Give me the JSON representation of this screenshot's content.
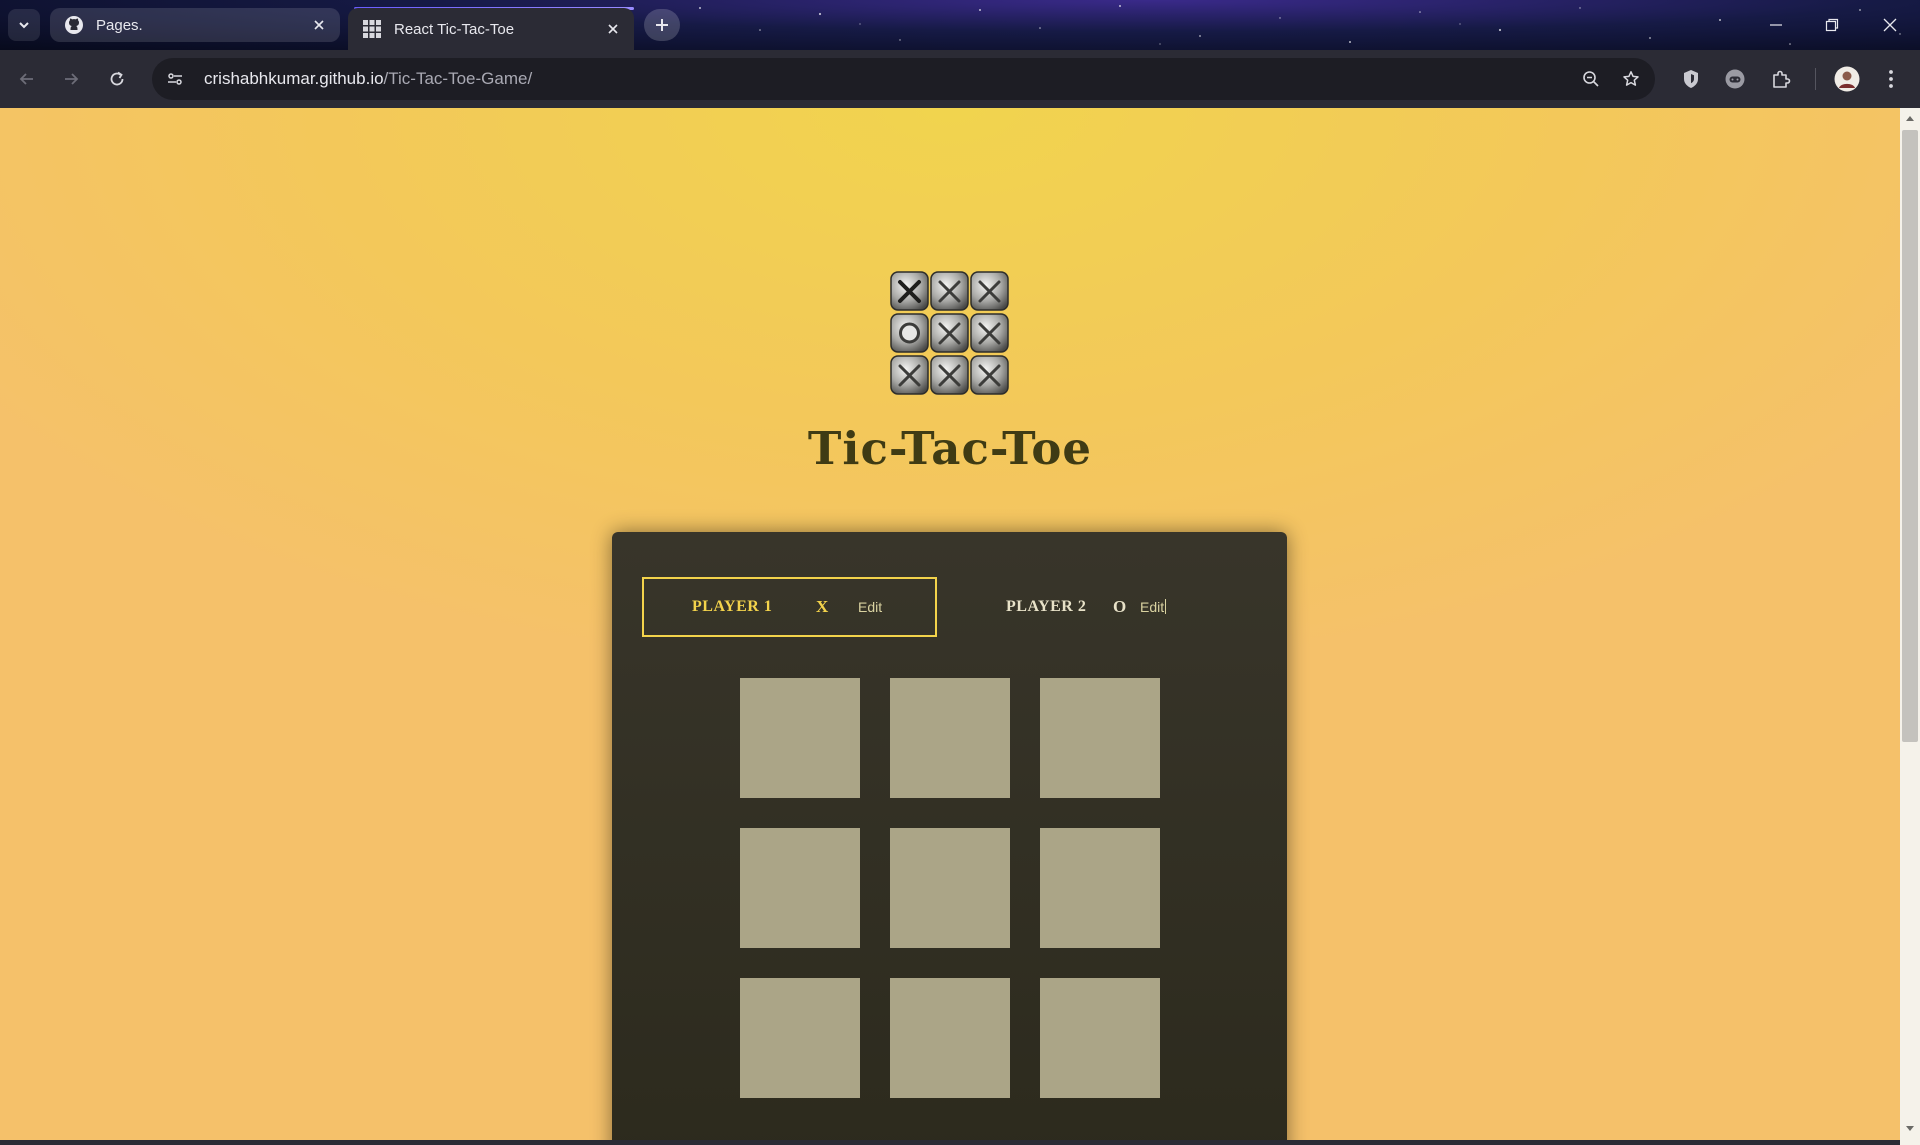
{
  "browser": {
    "tabs": [
      {
        "title": "Pages.",
        "favicon": "github-icon",
        "active": false
      },
      {
        "title": "React Tic-Tac-Toe",
        "favicon": "grid-icon",
        "active": true
      }
    ],
    "url_host": "crishabhkumar.github.io",
    "url_path": "/Tic-Tac-Toe-Game/",
    "accent_color": "#6a5cff"
  },
  "page": {
    "title": "Tic-Tac-Toe",
    "logo": "tic-tac-toe-logo",
    "colors": {
      "background": "#f3c85a",
      "title": "#3f3b14",
      "panel": "#2f2d22",
      "active_player": "#f3d34b",
      "cell": "#aba587"
    }
  },
  "players": [
    {
      "name": "PLAYER 1",
      "symbol": "X",
      "edit_label": "Edit",
      "active": true
    },
    {
      "name": "PLAYER 2",
      "symbol": "O",
      "edit_label": "Edit",
      "active": false
    }
  ],
  "board": [
    [
      "",
      "",
      ""
    ],
    [
      "",
      "",
      ""
    ],
    [
      "",
      "",
      ""
    ]
  ]
}
